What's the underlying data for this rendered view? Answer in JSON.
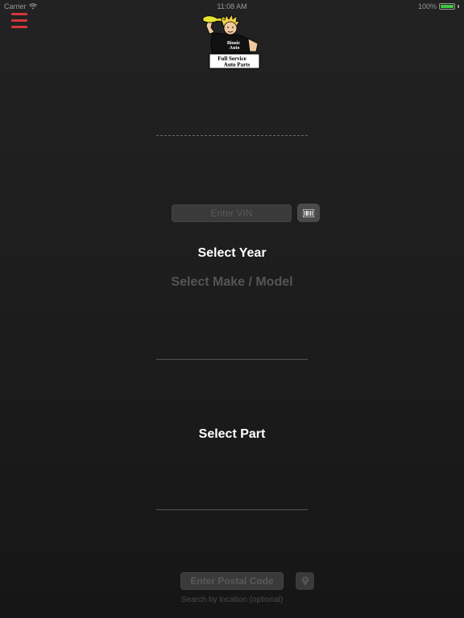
{
  "status_bar": {
    "carrier": "Carrier",
    "time": "11:08 AM",
    "battery": "100%",
    "battery_level": 1.0
  },
  "logo": {
    "line1": "Bionic",
    "line2": "Auto",
    "line3": "Full Service",
    "line4": "Auto Parts"
  },
  "vin": {
    "placeholder": "Enter VIN"
  },
  "vehicle": {
    "select_year": "Select Year",
    "select_make_model": "Select Make / Model"
  },
  "part": {
    "select_part": "Select Part"
  },
  "location": {
    "postal_placeholder": "Enter Postal Code",
    "hint": "Search by location (optional)"
  },
  "colors": {
    "menu_accent": "#d8343b",
    "battery_green": "#3ec63e",
    "logo_yellow": "#e8e230"
  },
  "icons": {
    "menu": "hamburger-menu-icon",
    "scan": "barcode-icon",
    "location": "location-pin-icon",
    "wifi": "wifi-icon",
    "battery": "battery-icon"
  }
}
